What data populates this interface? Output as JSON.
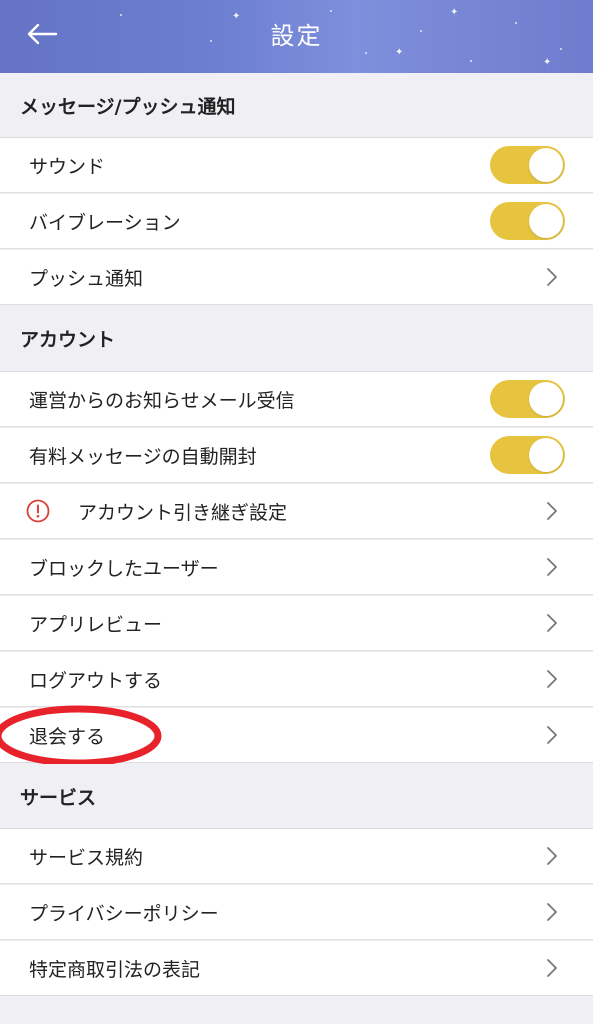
{
  "header": {
    "title": "設定",
    "gradient_colors": [
      "#6573c4",
      "#7e8fdc"
    ]
  },
  "sections": [
    {
      "title": "メッセージ/プッシュ通知",
      "items": [
        {
          "label": "サウンド",
          "control": "toggle",
          "on": true
        },
        {
          "label": "バイブレーション",
          "control": "toggle",
          "on": true
        },
        {
          "label": "プッシュ通知",
          "control": "chevron"
        }
      ]
    },
    {
      "title": "アカウント",
      "items": [
        {
          "label": "運営からのお知らせメール受信",
          "control": "toggle",
          "on": true
        },
        {
          "label": "有料メッセージの自動開封",
          "control": "toggle",
          "on": true
        },
        {
          "label": "アカウント引き継ぎ設定",
          "control": "chevron",
          "icon": "alert-icon"
        },
        {
          "label": "ブロックしたユーザー",
          "control": "chevron"
        },
        {
          "label": "アプリレビュー",
          "control": "chevron"
        },
        {
          "label": "ログアウトする",
          "control": "chevron"
        },
        {
          "label": "退会する",
          "control": "chevron"
        }
      ]
    },
    {
      "title": "サービス",
      "items": [
        {
          "label": "サービス規約",
          "control": "chevron"
        },
        {
          "label": "プライバシーポリシー",
          "control": "chevron"
        },
        {
          "label": "特定商取引法の表記",
          "control": "chevron"
        }
      ]
    }
  ],
  "colors": {
    "toggle_on": "#e7c440",
    "alert": "#d9413a",
    "annotation": "#e8222a",
    "background": "#efeff4"
  }
}
